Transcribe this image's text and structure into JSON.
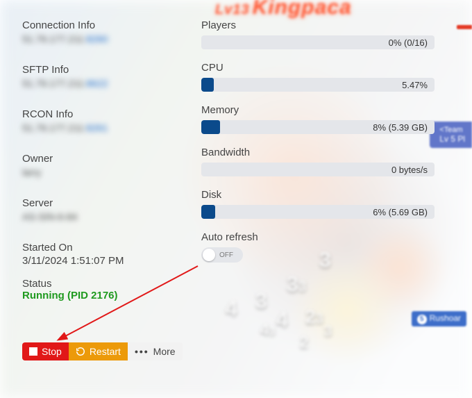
{
  "bg": {
    "lv": "Lv13",
    "name": "Kingpaca",
    "team_tag": "<Team",
    "team_lv": "Lv 5  Pl",
    "rushoar_n": "5",
    "rushoar": "Rushoar"
  },
  "left": {
    "connection": {
      "label": "Connection Info",
      "redacted_a": "51.79.177.211:",
      "redacted_b": "8260"
    },
    "sftp": {
      "label": "SFTP Info",
      "redacted_a": "51.79.177.211:",
      "redacted_b": "8622"
    },
    "rcon": {
      "label": "RCON Info",
      "redacted_a": "51.79.177.211:",
      "redacted_b": "8261"
    },
    "owner": {
      "label": "Owner",
      "redacted": "larry"
    },
    "server": {
      "label": "Server",
      "redacted": "AS-SIN-6-84"
    },
    "started": {
      "label": "Started On",
      "value": "3/11/2024 1:51:07 PM"
    },
    "status": {
      "label": "Status",
      "value": "Running (PID 2176)"
    }
  },
  "right": {
    "players": {
      "label": "Players",
      "text": "0% (0/16)",
      "fill_style": "width:0%"
    },
    "cpu": {
      "label": "CPU",
      "text": "5.47%",
      "fill_style": "width:5.47%"
    },
    "memory": {
      "label": "Memory",
      "text": "8% (5.39 GB)",
      "fill_style": "width:8%"
    },
    "bandwidth": {
      "label": "Bandwidth",
      "text": "0 bytes/s",
      "fill_style": "width:0%"
    },
    "disk": {
      "label": "Disk",
      "text": "6% (5.69 GB)",
      "fill_style": "width:6%"
    },
    "autorefresh": {
      "label": "Auto refresh",
      "state": "OFF"
    }
  },
  "actions": {
    "stop": "Stop",
    "restart": "Restart",
    "more": "More"
  }
}
